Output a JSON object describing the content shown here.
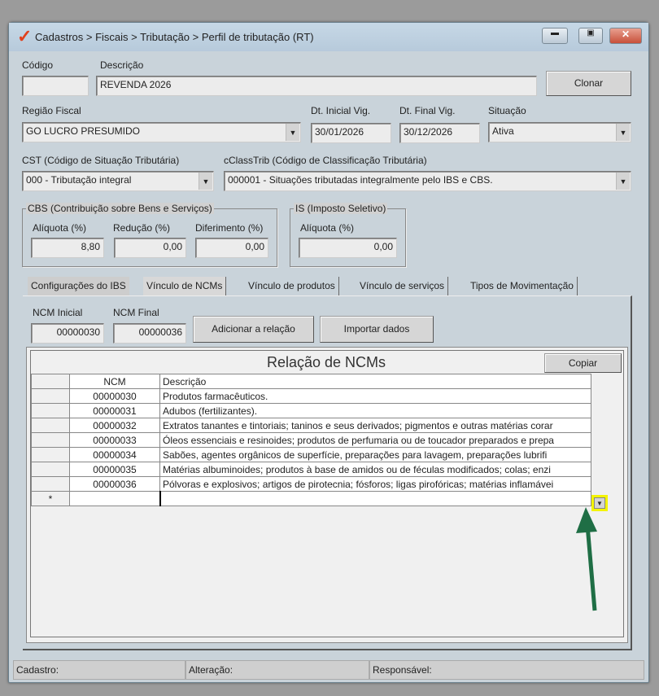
{
  "window": {
    "title": "Cadastros > Fiscais > Tributação > Perfil de tributação (RT)",
    "accent": "#e0401c"
  },
  "form": {
    "codigo_label": "Código",
    "codigo_value": "",
    "descricao_label": "Descrição",
    "descricao_value": "REVENDA 2026",
    "clonar_label": "Clonar",
    "regiao_label": "Região Fiscal",
    "regiao_value": "GO LUCRO PRESUMIDO",
    "dt_inicial_label": "Dt. Inicial Vig.",
    "dt_inicial_value": "30/01/2026",
    "dt_final_label": "Dt. Final Vig.",
    "dt_final_value": "30/12/2026",
    "situacao_label": "Situação",
    "situacao_value": "Ativa",
    "cst_label": "CST (Código de Situação Tributária)",
    "cst_value": "000 - Tributação integral",
    "cclass_label": "cClassTrib (Código de Classificação Tributária)",
    "cclass_value": "000001 - Situações tributadas integralmente pelo IBS e CBS."
  },
  "cbs": {
    "title": "CBS (Contribuição sobre Bens e Serviços)",
    "aliquota_label": "Alíquota (%)",
    "aliquota": "8,80",
    "reducao_label": "Redução (%)",
    "reducao": "0,00",
    "diferimento_label": "Diferimento (%)",
    "diferimento": "0,00"
  },
  "is": {
    "title": "IS (Imposto Seletivo)",
    "aliquota_label": "Alíquota (%)",
    "aliquota": "0,00"
  },
  "tabs": [
    "Configurações do IBS",
    "Vínculo de NCMs",
    "Vínculo de produtos",
    "Vínculo de serviços",
    "Tipos de Movimentação"
  ],
  "ncm_panel": {
    "inicial_label": "NCM Inicial",
    "inicial": "00000030",
    "final_label": "NCM Final",
    "final": "00000036",
    "add_label": "Adicionar a relação",
    "import_label": "Importar dados"
  },
  "grid": {
    "title": "Relação de NCMs",
    "copy_label": "Copiar",
    "columns": [
      "NCM",
      "Descrição"
    ],
    "new_row_marker": "*",
    "rows": [
      {
        "ncm": "00000030",
        "desc": "Produtos farmacêuticos."
      },
      {
        "ncm": "00000031",
        "desc": "Adubos (fertilizantes)."
      },
      {
        "ncm": "00000032",
        "desc": "Extratos tanantes e tintoriais; taninos e seus derivados; pigmentos e outras matérias corar"
      },
      {
        "ncm": "00000033",
        "desc": "Óleos essenciais e resinoides; produtos de perfumaria ou de toucador preparados e prepa"
      },
      {
        "ncm": "00000034",
        "desc": "Sabões, agentes orgânicos de superfície, preparações para lavagem, preparações lubrifi"
      },
      {
        "ncm": "00000035",
        "desc": "Matérias albuminoides; produtos à base de amidos ou de féculas modificados; colas; enzi"
      },
      {
        "ncm": "00000036",
        "desc": "Pólvoras e explosivos; artigos de pirotecnia; fósforos; ligas pirofóricas; matérias inflamávei"
      }
    ]
  },
  "status": {
    "cadastro": "Cadastro:",
    "alteracao": "Alteração:",
    "responsavel": "Responsável:"
  },
  "annotation": {
    "highlight_color": "#f4f400",
    "arrow_color": "#1f6e45"
  }
}
